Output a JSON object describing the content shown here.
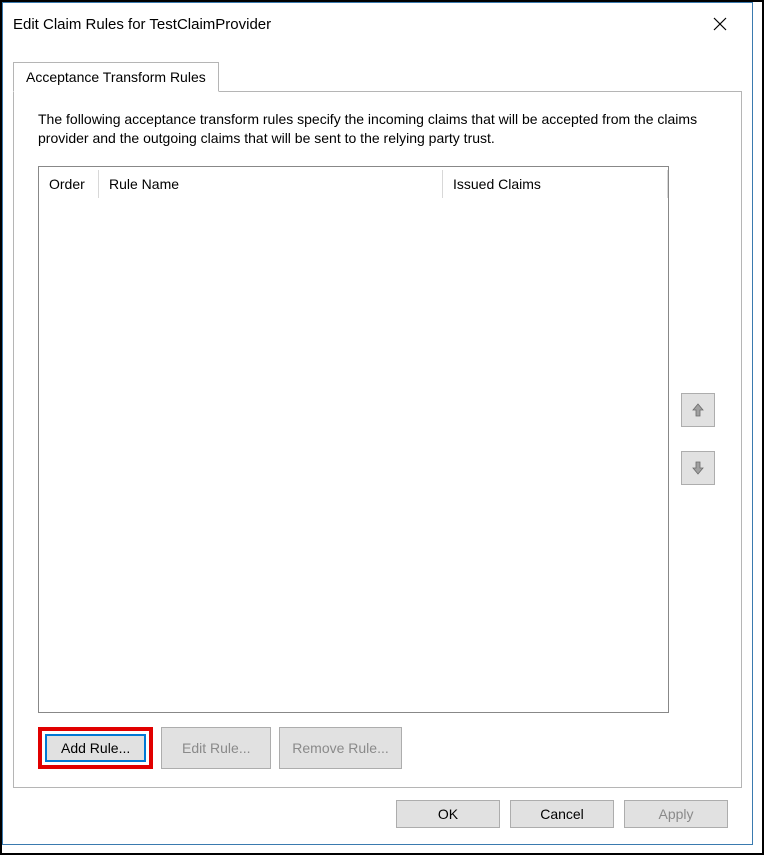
{
  "window": {
    "title": "Edit Claim Rules for TestClaimProvider"
  },
  "tabs": {
    "active_label": "Acceptance Transform Rules"
  },
  "panel": {
    "description": "The following acceptance transform rules specify the incoming claims that will be accepted from the claims provider and the outgoing claims that will be sent to the relying party trust."
  },
  "columns": {
    "order": "Order",
    "rule_name": "Rule Name",
    "issued_claims": "Issued Claims"
  },
  "rows": [],
  "rule_buttons": {
    "add": "Add Rule...",
    "edit": "Edit Rule...",
    "remove": "Remove Rule..."
  },
  "dialog_buttons": {
    "ok": "OK",
    "cancel": "Cancel",
    "apply": "Apply"
  }
}
